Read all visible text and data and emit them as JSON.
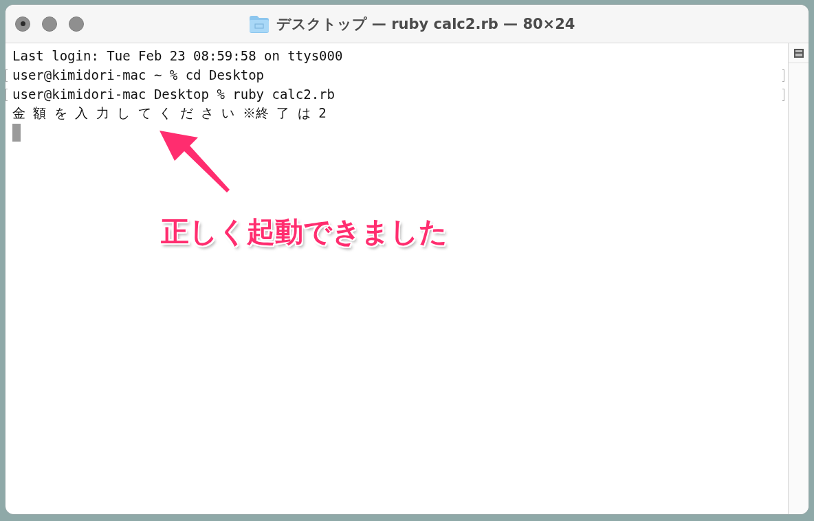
{
  "window": {
    "title": "デスクトップ — ruby calc2.rb — 80×24"
  },
  "terminal": {
    "lines": [
      {
        "text": "Last login: Tue Feb 23 08:59:58 on ttys000",
        "marked": false
      },
      {
        "text": "user@kimidori-mac ~ % cd Desktop",
        "marked": true
      },
      {
        "text": "user@kimidori-mac Desktop % ruby calc2.rb",
        "marked": true
      },
      {
        "text": "金 額 を 入 力 し て く だ さ い ※終 了 は 2",
        "marked": false
      }
    ],
    "cursor": true
  },
  "annotation": {
    "text": "正しく起動できました"
  }
}
